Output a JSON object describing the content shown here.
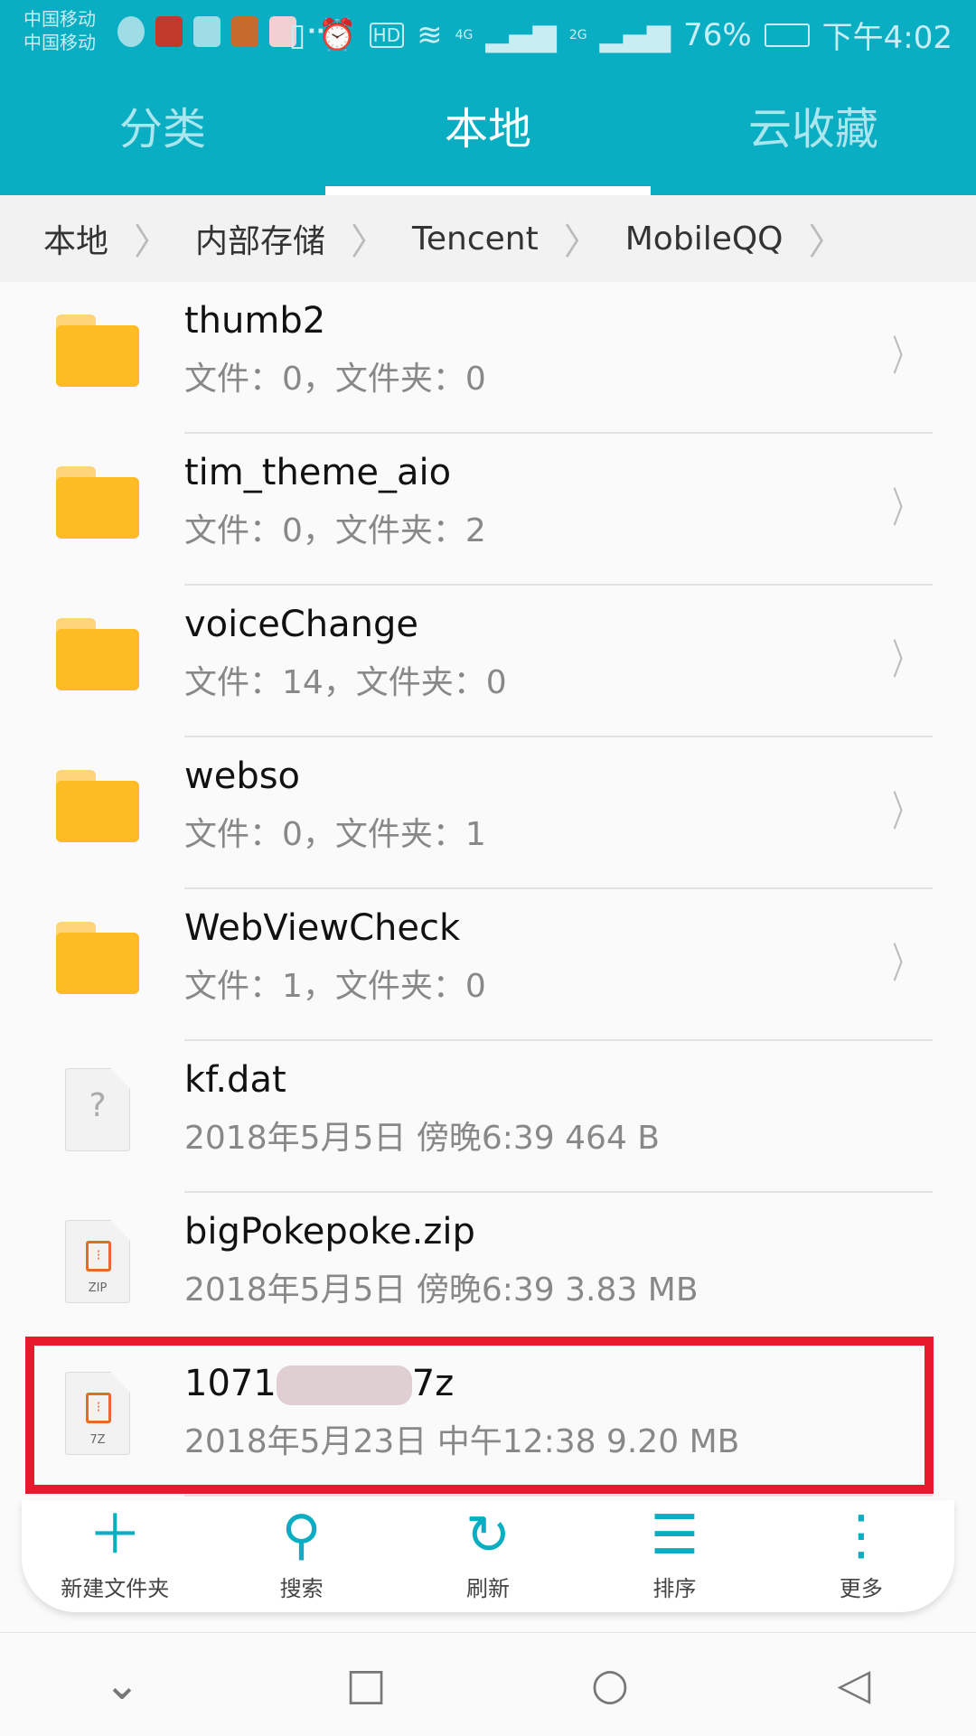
{
  "status": {
    "carrier1": "中国移动",
    "carrier2": "中国移动",
    "more": "···",
    "network": "4G",
    "network2": "2G",
    "battery": "76%",
    "time": "下午4:02"
  },
  "tabs": [
    {
      "label": "分类"
    },
    {
      "label": "本地",
      "active": true
    },
    {
      "label": "云收藏"
    }
  ],
  "breadcrumb": [
    "本地",
    "内部存储",
    "Tencent",
    "MobileQQ"
  ],
  "items": [
    {
      "name": "thumb2",
      "meta": "文件：0，文件夹：0",
      "type": "folder"
    },
    {
      "name": "tim_theme_aio",
      "meta": "文件：0，文件夹：2",
      "type": "folder"
    },
    {
      "name": "voiceChange",
      "meta": "文件：14，文件夹：0",
      "type": "folder"
    },
    {
      "name": "webso",
      "meta": "文件：0，文件夹：1",
      "type": "folder"
    },
    {
      "name": "WebViewCheck",
      "meta": "文件：1，文件夹：0",
      "type": "folder"
    },
    {
      "name": "kf.dat",
      "meta": "2018年5月5日 傍晚6:39 464 B",
      "type": "unknown"
    },
    {
      "name": "bigPokepoke.zip",
      "meta": "2018年5月5日 傍晚6:39 3.83 MB",
      "type": "zip",
      "ext": "ZIP"
    },
    {
      "name_prefix": "1071",
      "name_suffix": "7z",
      "meta": "2018年5月23日 中午12:38 9.20 MB",
      "type": "7z",
      "ext": "7Z"
    }
  ],
  "toolbar": [
    {
      "label": "新建文件夹",
      "icon": "plus-icon"
    },
    {
      "label": "搜索",
      "icon": "search-icon"
    },
    {
      "label": "刷新",
      "icon": "refresh-icon"
    },
    {
      "label": "排序",
      "icon": "sort-icon"
    },
    {
      "label": "更多",
      "icon": "more-icon"
    }
  ],
  "colors": {
    "accent": "#0aaec3",
    "folder": "#fdbb24",
    "highlight": "#e8192c"
  }
}
